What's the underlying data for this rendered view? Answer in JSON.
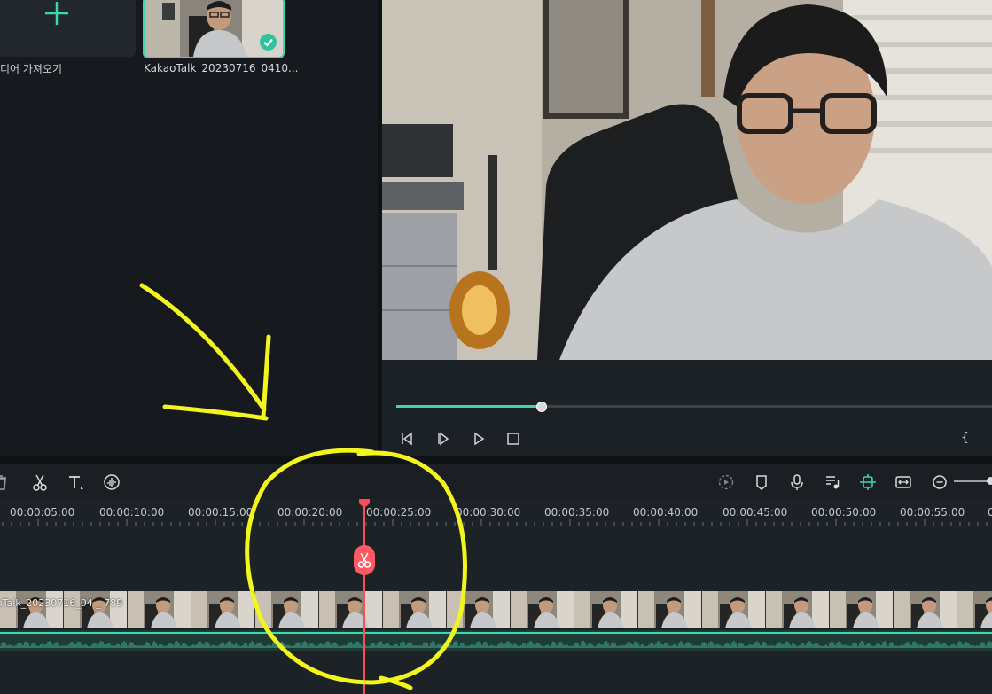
{
  "media": {
    "import_label": "디어 가져오기",
    "clip_name": "KakaoTalk_20230716_0410..."
  },
  "colors": {
    "accent": "#3fd6b0",
    "playhead": "#ff4d57",
    "annotation": "#f2f51e"
  },
  "player": {
    "progress": 0.24
  },
  "toolbar": {
    "left_tools": [
      "delete-icon",
      "scissors-icon",
      "text-icon",
      "audio-wave-icon"
    ],
    "right_tools": [
      "render-icon",
      "marker-icon",
      "mic-icon",
      "music-icon",
      "snap-icon",
      "fit-icon",
      "zoom-out-icon"
    ]
  },
  "timeline": {
    "ticks": [
      "00:00:05:00",
      "00:00:10:00",
      "00:00:15:00",
      "00:00:20:00",
      "00:00:25:00",
      "00:00:30:00",
      "00:00:35:00",
      "00:00:40:00",
      "00:00:45:00",
      "00:00:50:00",
      "00:00:55:00",
      "0"
    ],
    "video_clip_label": "oTalk_20230716_04 _ 789"
  }
}
